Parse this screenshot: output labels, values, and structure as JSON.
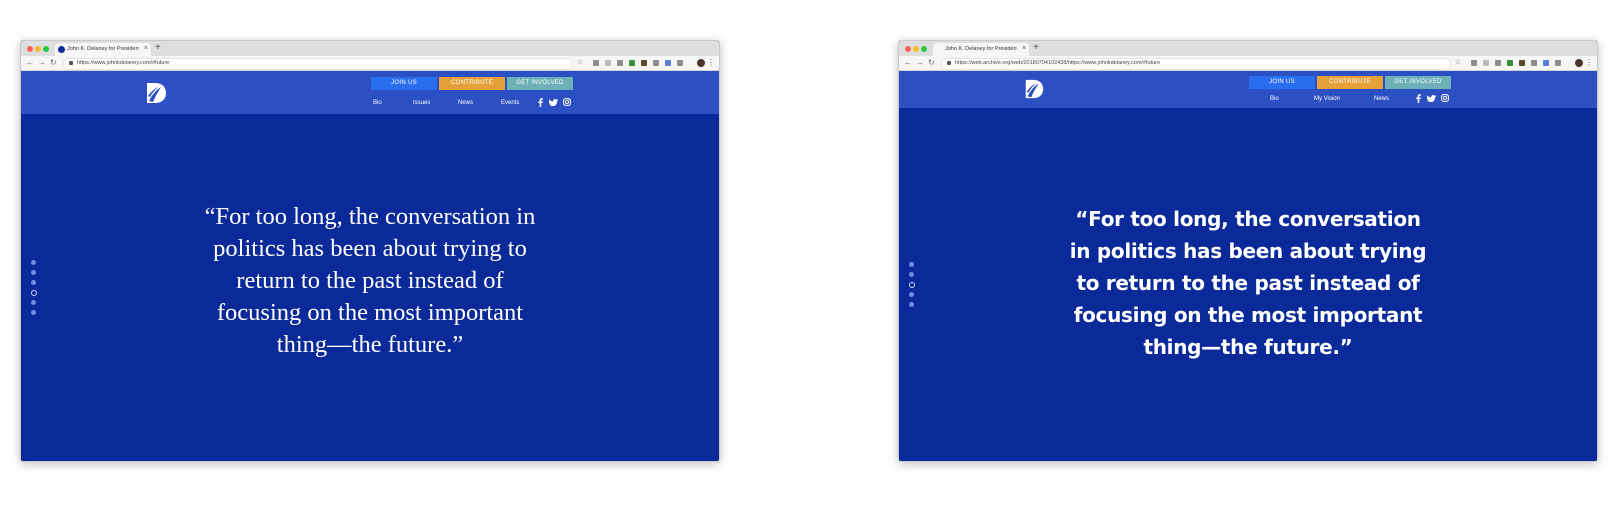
{
  "left": {
    "tab_title": "John K. Delaney for President",
    "url": "https://www.johnkdelaney.com/#future",
    "buttons": {
      "join": "JOIN US",
      "contribute": "CONTRIBUTE",
      "involved": "GET INVOLVED"
    },
    "nav": [
      "Bio",
      "Issues",
      "News",
      "Events"
    ],
    "quote_lines": [
      "“For too long, the conversation in",
      "politics has been about trying to",
      "return to the past instead of",
      "focusing on the most important",
      "thing—the future.”"
    ]
  },
  "right": {
    "tab_title": "John K. Delaney for President",
    "url": "https://web.archive.org/web/20180704102438/https://www.johnkdelaney.com/#future",
    "buttons": {
      "join": "JOIN US",
      "contribute": "CONTRIBUTE",
      "involved": "GET INVOLVED"
    },
    "nav": [
      "Bio",
      "My Vision",
      "News"
    ],
    "quote_lines": [
      "“For too long, the conversation",
      "in politics has been about trying",
      "to return to the past instead of",
      "focusing on the most important",
      "thing—the future.”"
    ]
  },
  "icons": {
    "social": [
      "facebook-icon",
      "twitter-icon",
      "instagram-icon"
    ],
    "logo": "delaney-d-logo"
  },
  "colors": {
    "header": "#2c50c4",
    "body": "#0b2a99",
    "join": "#2a6ef0",
    "contribute": "#e6a03a",
    "involved": "#6db0b6"
  }
}
